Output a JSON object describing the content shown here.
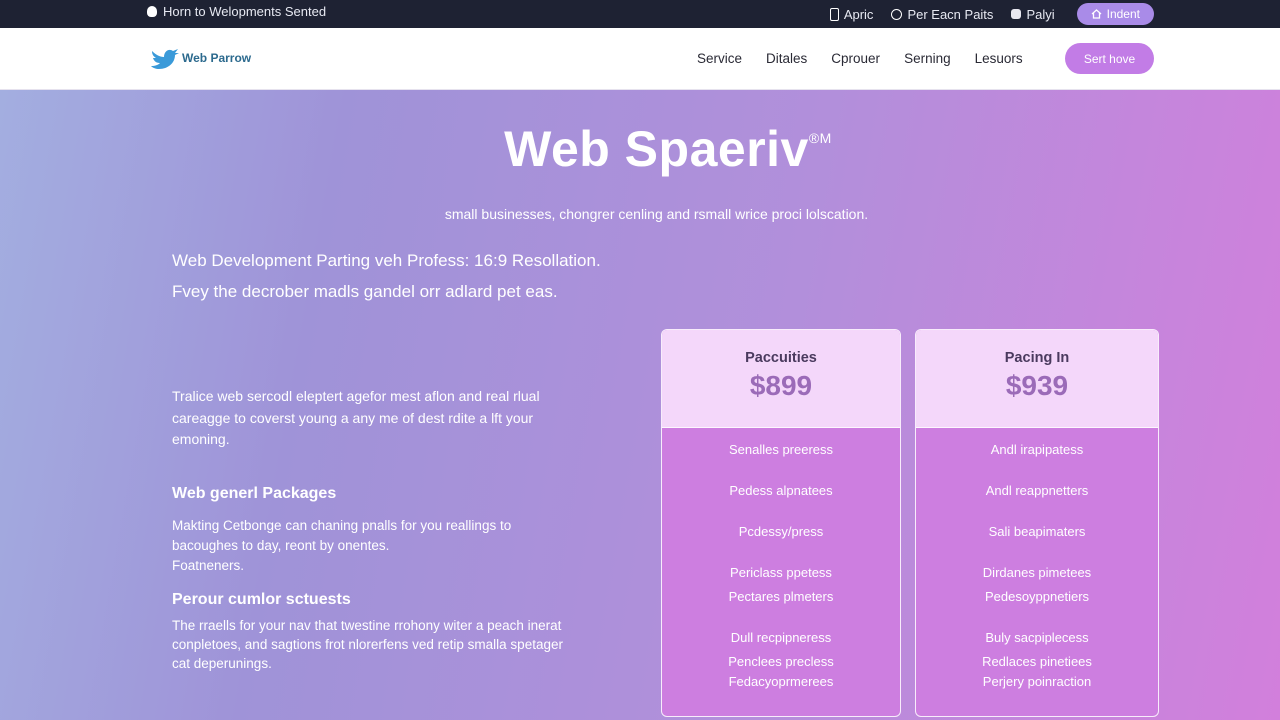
{
  "topbar": {
    "left_text": "Horn to Welopments Sented",
    "right_items": [
      {
        "label": "Apric",
        "icon": "phone-icon"
      },
      {
        "label": "Per Eacn Paits",
        "icon": "chat-icon"
      },
      {
        "label": "Palyi",
        "icon": "square-icon"
      }
    ],
    "pill_label": "Indent"
  },
  "nav": {
    "logo_text": "Web Parrow",
    "links": [
      "Service",
      "Ditales",
      "Cprouer",
      "Serning",
      "Lesuors"
    ],
    "cta_label": "Sert hove"
  },
  "hero": {
    "title": "Web Spaeriv",
    "title_mark": "®M",
    "subtitle": "small businesses, chongrer cenling and rsmall wrice proci lolscation.",
    "lead1": "Web Development Parting veh Profess: 16:9 Resollation.",
    "lead2": "Fvey the decrober madls gandel orr adlard pet eas.",
    "intro": "Tralice web sercodl eleptert agefor mest aflon and real rlual careagge to coverst young a any me of dest rdite a lft your emoning.",
    "packages_heading": "Web generl Packages",
    "packages_text_1": "Makting Cetbonge can chaning pnalls for you reallings to bacoughes to day, reont by onentes.",
    "packages_text_2": "Foatneners.",
    "custom_heading": "Perour cumlor sctuests",
    "custom_text": "The rraells for your nav that twestine rrohony witer a peach inerat conpletoes, and sagtions frot nlorerfens ved retip smalla spetager cat deperunings."
  },
  "pricing": [
    {
      "plan": "Paccuities",
      "price": "$899",
      "features": [
        "Senalles preeress",
        "Pedess alpnatees",
        "Pcdessy/press",
        "Periclass ppetess",
        "Pectares plmeters",
        "Dull recpipneress",
        "Penclees precless",
        "Fedacyoprmerees"
      ]
    },
    {
      "plan": "Pacing In",
      "price": "$939",
      "features": [
        "Andl irapipatess",
        "Andl reappnetters",
        "Sali beapimaters",
        "Dirdanes pimetees",
        "Pedesoyppnetiers",
        "Buly sacpiplecess",
        "Redlaces pinetiees",
        "Perjery poinraction"
      ]
    }
  ]
}
